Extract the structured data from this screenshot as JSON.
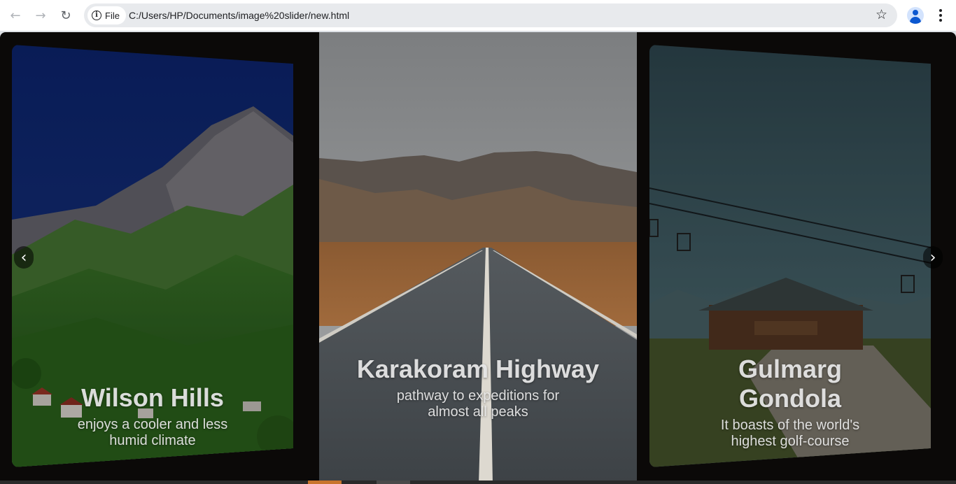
{
  "browser": {
    "back_icon": "arrow-left-icon",
    "forward_icon": "arrow-right-icon",
    "reload_icon": "reload-icon",
    "chip_label": "File",
    "url": "C:/Users/HP/Documents/image%20slider/new.html",
    "bookmark_icon": "star-icon",
    "profile_icon": "profile-icon",
    "menu_icon": "kebab-menu-icon"
  },
  "slider": {
    "prev_label": "‹",
    "next_label": "›",
    "slides": [
      {
        "title": "Wilson Hills",
        "text": "enjoys a cooler and less humid climate",
        "scene": "alpine mountain with green valley and village"
      },
      {
        "title": "Karakoram Highway",
        "text": "pathway to expeditions for almost all peaks",
        "scene": "straight road leading to mountains"
      },
      {
        "title": "Gulmarg Gondola",
        "text": "It boasts of the world's highest golf-course",
        "scene": "cable car line over wooden lodge"
      }
    ],
    "colors": {
      "background": "#0b0908",
      "caption": "#ebebeb",
      "active_indicator": "#c8742c"
    }
  }
}
